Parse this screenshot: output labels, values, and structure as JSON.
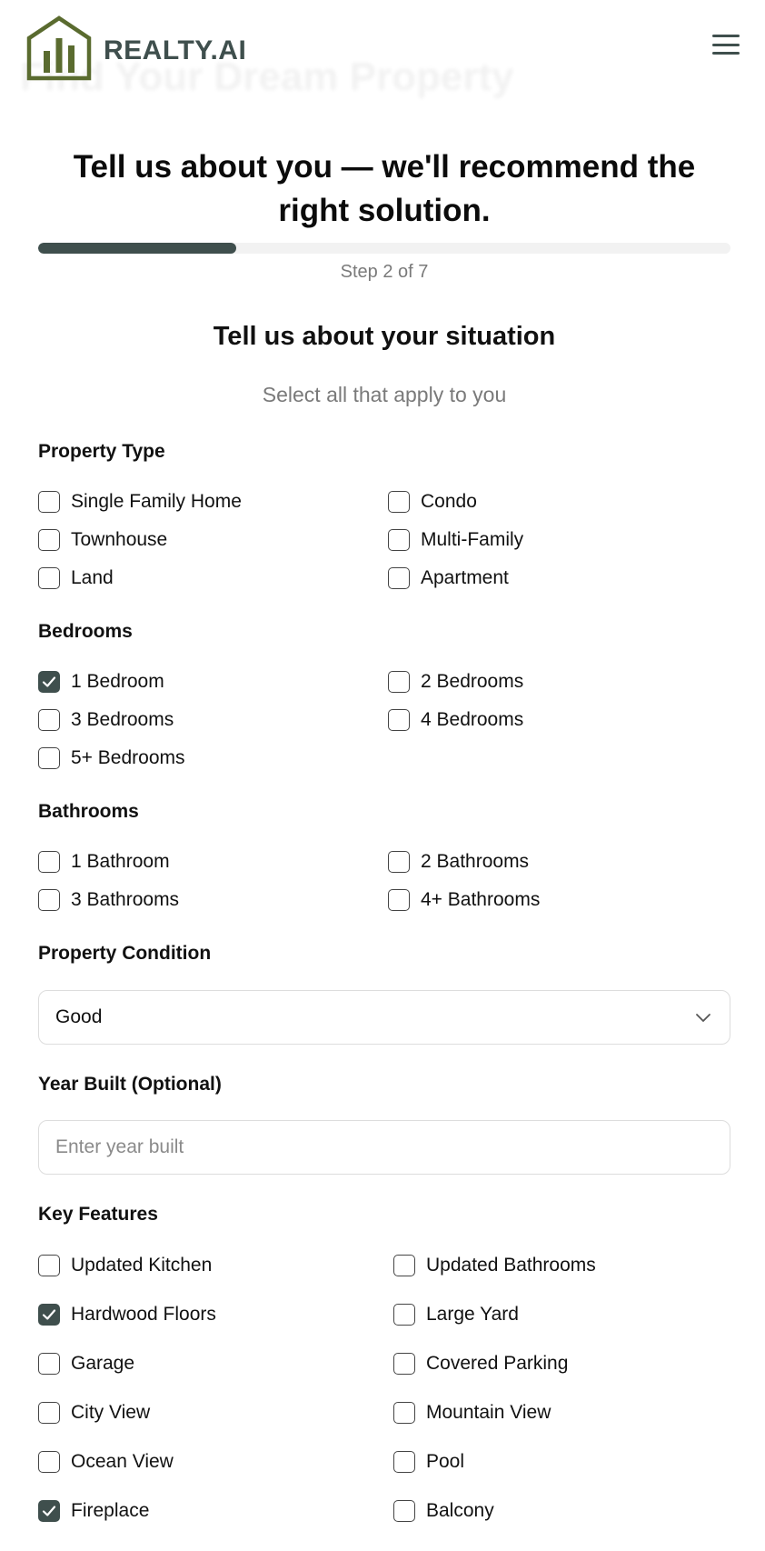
{
  "brand": {
    "name": "REALTY.AI",
    "background_headline": "Find Your Dream Property",
    "color": "#3f4f4d",
    "logo_color": "#5a6b2f"
  },
  "main_title": "Tell us about you — we'll recommend the right solution.",
  "progress": {
    "current": 2,
    "total": 7,
    "label": "Step 2 of 7",
    "fraction": 0.2857
  },
  "section": {
    "title": "Tell us about your situation",
    "subtitle": "Select all that apply to you"
  },
  "property_type": {
    "label": "Property Type",
    "options": [
      {
        "label": "Single Family Home",
        "checked": false
      },
      {
        "label": "Condo",
        "checked": false
      },
      {
        "label": "Townhouse",
        "checked": false
      },
      {
        "label": "Multi-Family",
        "checked": false
      },
      {
        "label": "Land",
        "checked": false
      },
      {
        "label": "Apartment",
        "checked": false
      }
    ]
  },
  "bedrooms": {
    "label": "Bedrooms",
    "options": [
      {
        "label": "1 Bedroom",
        "checked": true
      },
      {
        "label": "2 Bedrooms",
        "checked": false
      },
      {
        "label": "3 Bedrooms",
        "checked": false
      },
      {
        "label": "4 Bedrooms",
        "checked": false
      },
      {
        "label": "5+ Bedrooms",
        "checked": false
      }
    ]
  },
  "bathrooms": {
    "label": "Bathrooms",
    "options": [
      {
        "label": "1 Bathroom",
        "checked": false
      },
      {
        "label": "2 Bathrooms",
        "checked": false
      },
      {
        "label": "3 Bathrooms",
        "checked": false
      },
      {
        "label": "4+ Bathrooms",
        "checked": false
      }
    ]
  },
  "condition": {
    "label": "Property Condition",
    "selected": "Good"
  },
  "year_built": {
    "label": "Year Built (Optional)",
    "value": "",
    "placeholder": "Enter year built"
  },
  "key_features": {
    "label": "Key Features",
    "options": [
      {
        "label": "Updated Kitchen",
        "checked": false
      },
      {
        "label": "Updated Bathrooms",
        "checked": false
      },
      {
        "label": "Hardwood Floors",
        "checked": true
      },
      {
        "label": "Large Yard",
        "checked": false
      },
      {
        "label": "Garage",
        "checked": false
      },
      {
        "label": "Covered Parking",
        "checked": false
      },
      {
        "label": "City View",
        "checked": false
      },
      {
        "label": "Mountain View",
        "checked": false
      },
      {
        "label": "Ocean View",
        "checked": false
      },
      {
        "label": "Pool",
        "checked": false
      },
      {
        "label": "Fireplace",
        "checked": true
      },
      {
        "label": "Balcony",
        "checked": false
      }
    ]
  }
}
